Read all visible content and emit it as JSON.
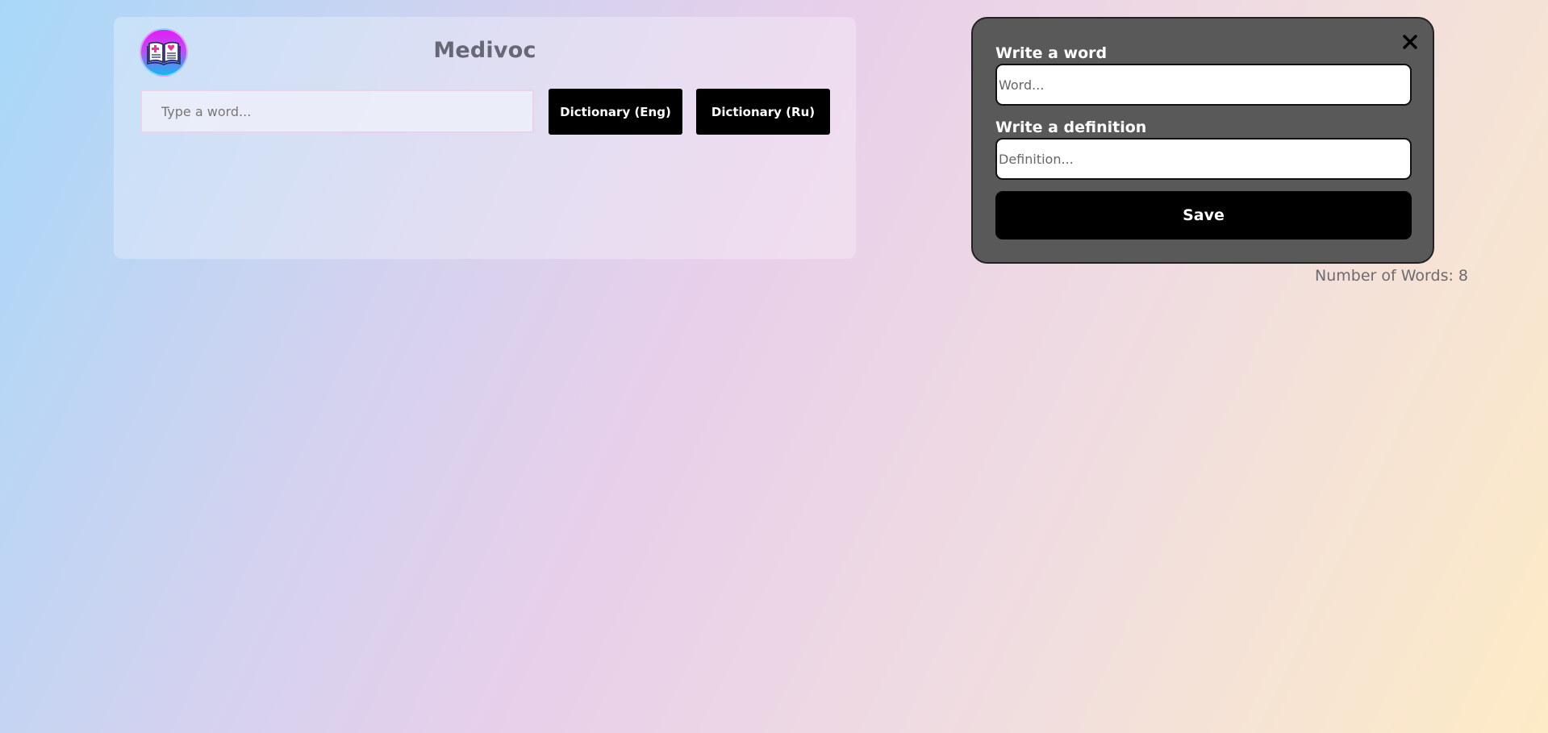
{
  "app": {
    "title": "Medivoc"
  },
  "search": {
    "placeholder": "Type a word...",
    "value": ""
  },
  "buttons": {
    "dictionary_eng": "Dictionary (Eng)",
    "dictionary_ru": "Dictionary (Ru)"
  },
  "modal": {
    "close_icon": "close-icon",
    "word_label": "Write a word",
    "word_placeholder": "Word...",
    "definition_label": "Write a definition",
    "definition_placeholder": "Definition...",
    "save_label": "Save"
  },
  "stats": {
    "word_count_text": "Number of Words: 8"
  },
  "icons": {
    "logo": "book-medical-icon"
  },
  "colors": {
    "button_bg": "#000000",
    "modal_bg": "#595959",
    "title_color": "#676776"
  }
}
